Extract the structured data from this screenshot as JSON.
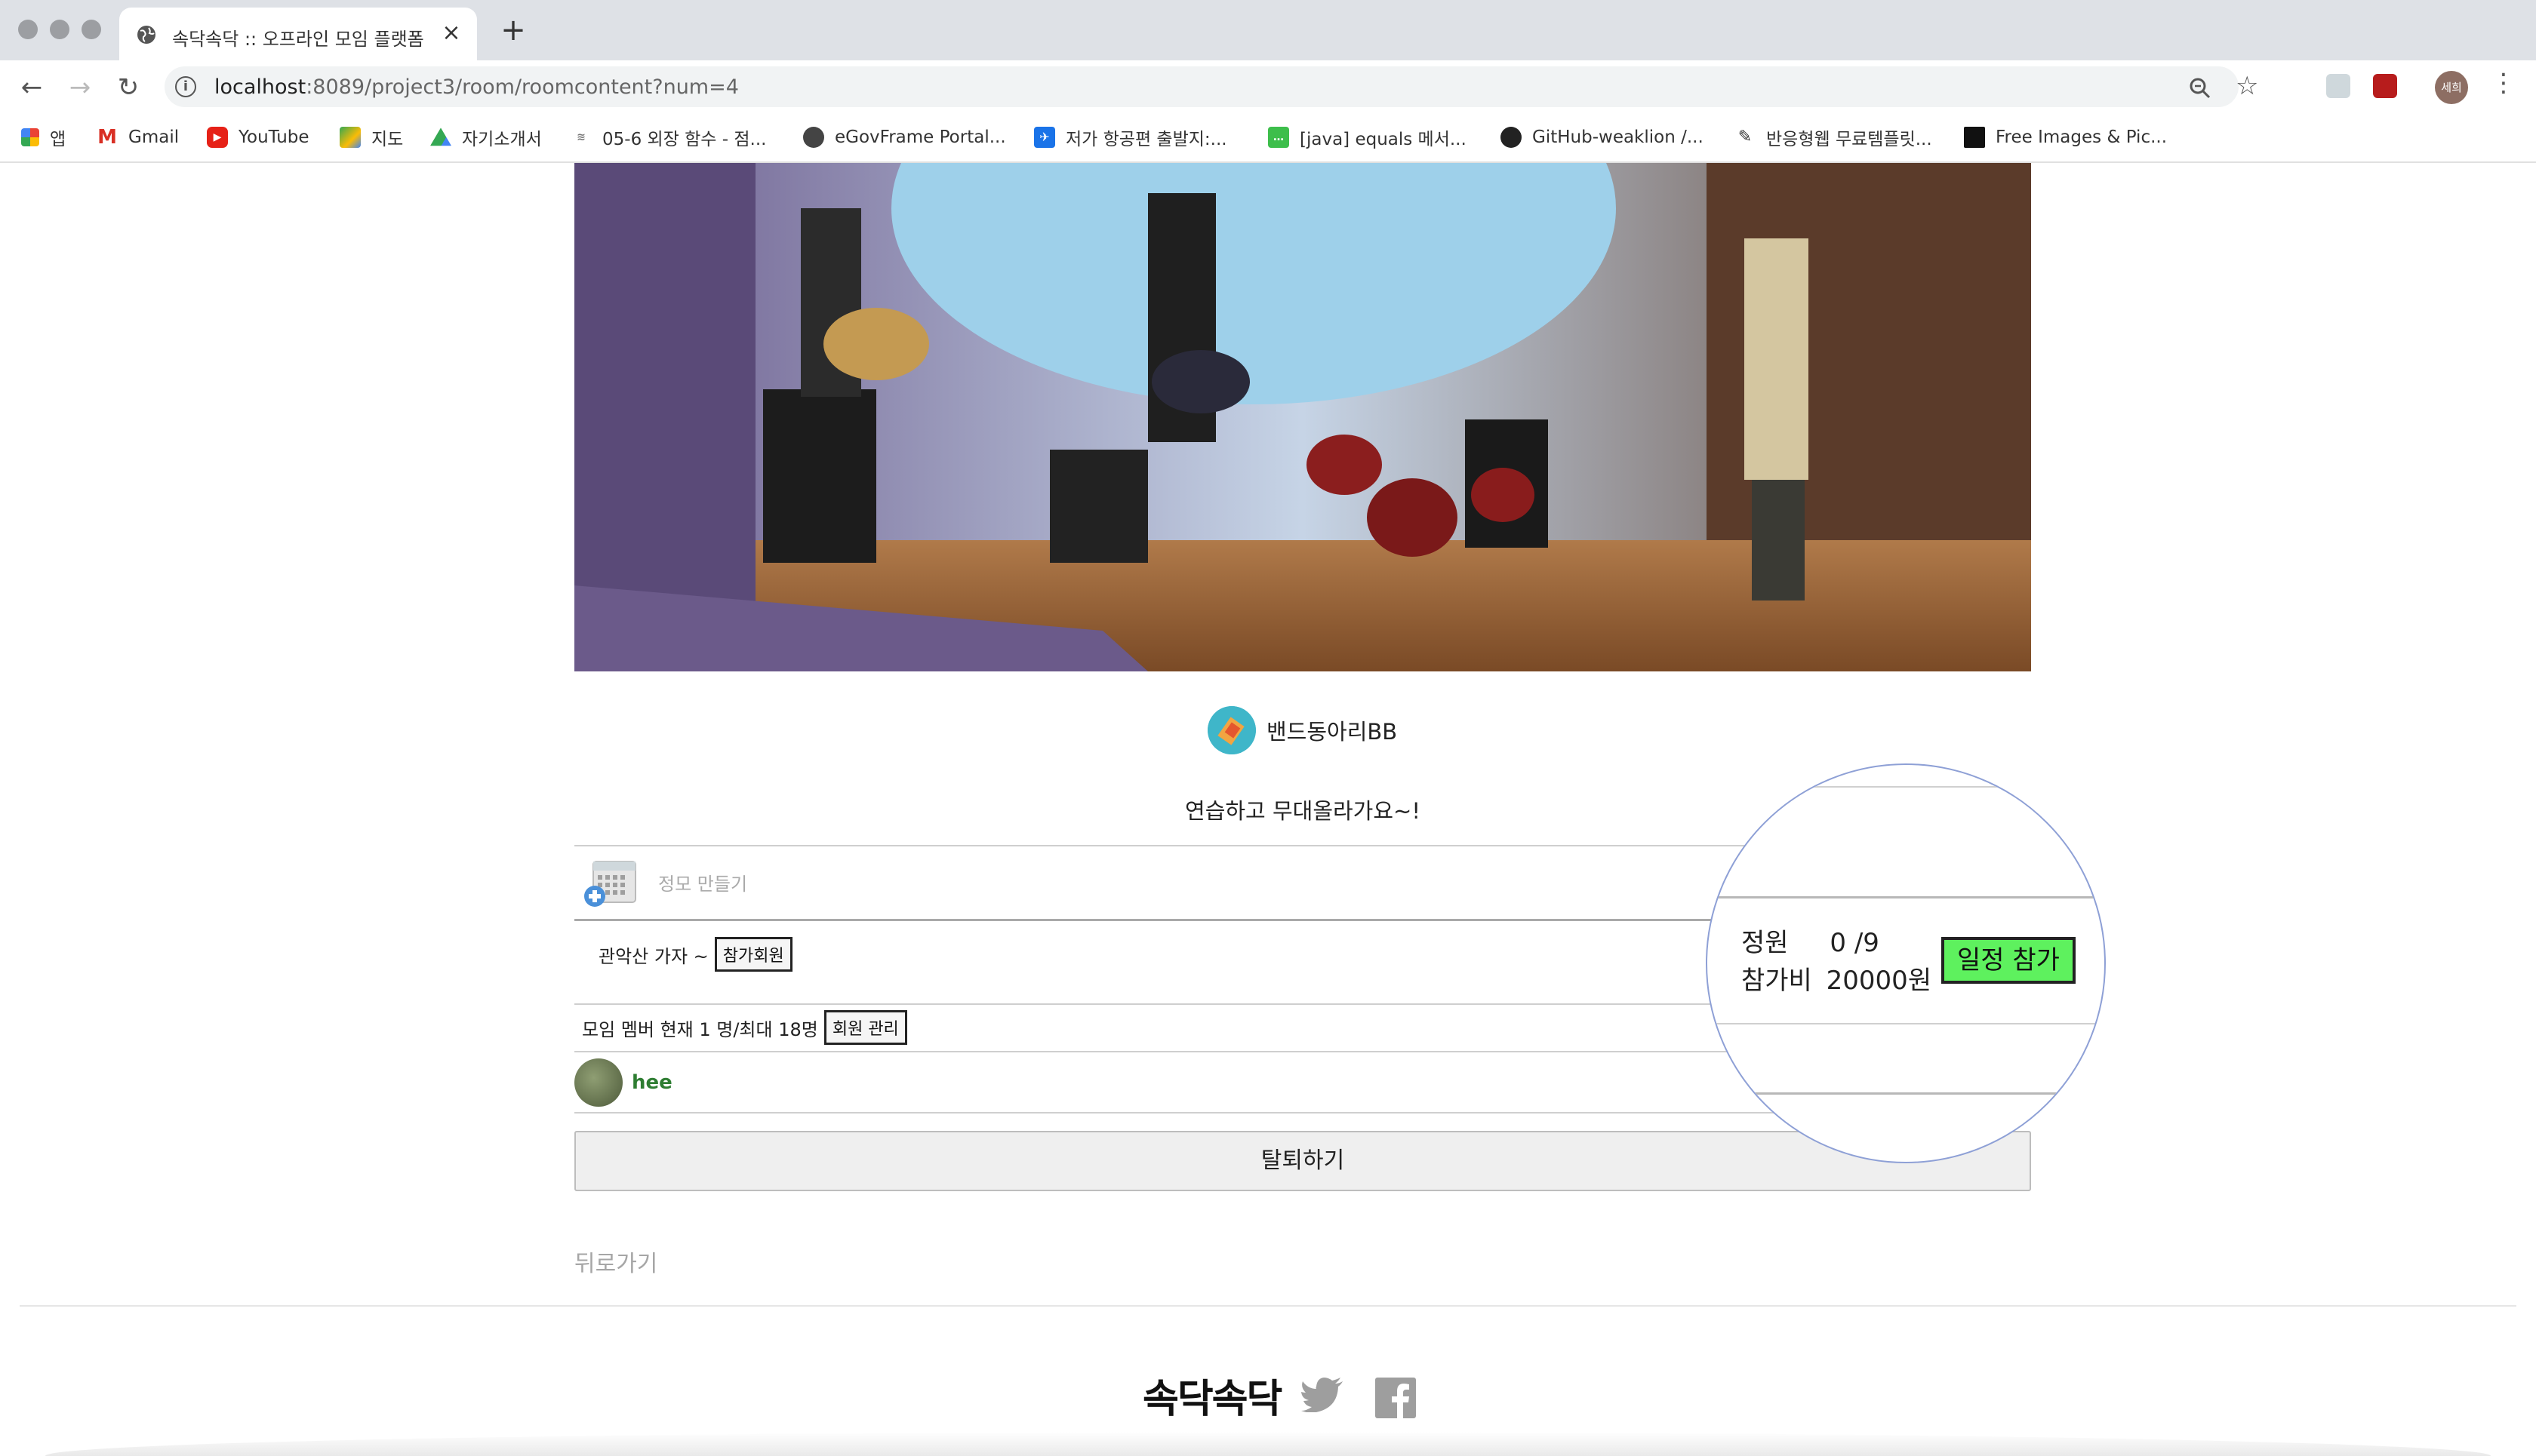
{
  "browser": {
    "tab_title": "속닥속닥 :: 오프라인 모임 플랫폼",
    "url_host": "localhost",
    "url_rest": ":8089/project3/room/roomcontent?num=4",
    "profile_chip": "세희",
    "bookmarks": [
      {
        "label": "앱",
        "icon": "apps-grid-icon"
      },
      {
        "label": "Gmail",
        "icon": "gmail-icon"
      },
      {
        "label": "YouTube",
        "icon": "youtube-icon"
      },
      {
        "label": "지도",
        "icon": "maps-icon"
      },
      {
        "label": "자기소개서",
        "icon": "drive-icon"
      },
      {
        "label": "05-6 외장 함수 - 점...",
        "icon": "wikidocs-icon"
      },
      {
        "label": "eGovFrame Portal...",
        "icon": "globe-icon"
      },
      {
        "label": "저가 항공편 출발지:...",
        "icon": "flight-icon"
      },
      {
        "label": "[java] equals 메서...",
        "icon": "chat-icon"
      },
      {
        "label": "GitHub-weaklion /...",
        "icon": "github-icon"
      },
      {
        "label": "반응형웹 무료템플릿...",
        "icon": "pen-icon"
      },
      {
        "label": "Free Images & Pic...",
        "icon": "unsplash-icon"
      }
    ]
  },
  "club": {
    "name": "밴드동아리BB",
    "description": "연습하고 무대올라가요~!"
  },
  "meetup": {
    "create_label": "정모 만들기"
  },
  "event": {
    "title": "관악산 가자 ~",
    "participants_button": "참가회원"
  },
  "members": {
    "summary": "모임 멤버 현재 1 명/최대 18명",
    "manage_button": "회원 관리",
    "list": [
      {
        "name": "hee"
      }
    ]
  },
  "magnified": {
    "capacity_label": "정원",
    "capacity_value": "0 /9",
    "fee_label": "참가비",
    "fee_value": "20000원",
    "join_button": "일정 참가"
  },
  "actions": {
    "leave_button": "탈퇴하기",
    "back_link": "뒤로가기"
  },
  "footer": {
    "logo": "속닥속닥"
  },
  "colors": {
    "join_button_bg": "#5ef15e",
    "member_name": "#2e7d32",
    "magnifier_border": "#8ea0d6"
  }
}
